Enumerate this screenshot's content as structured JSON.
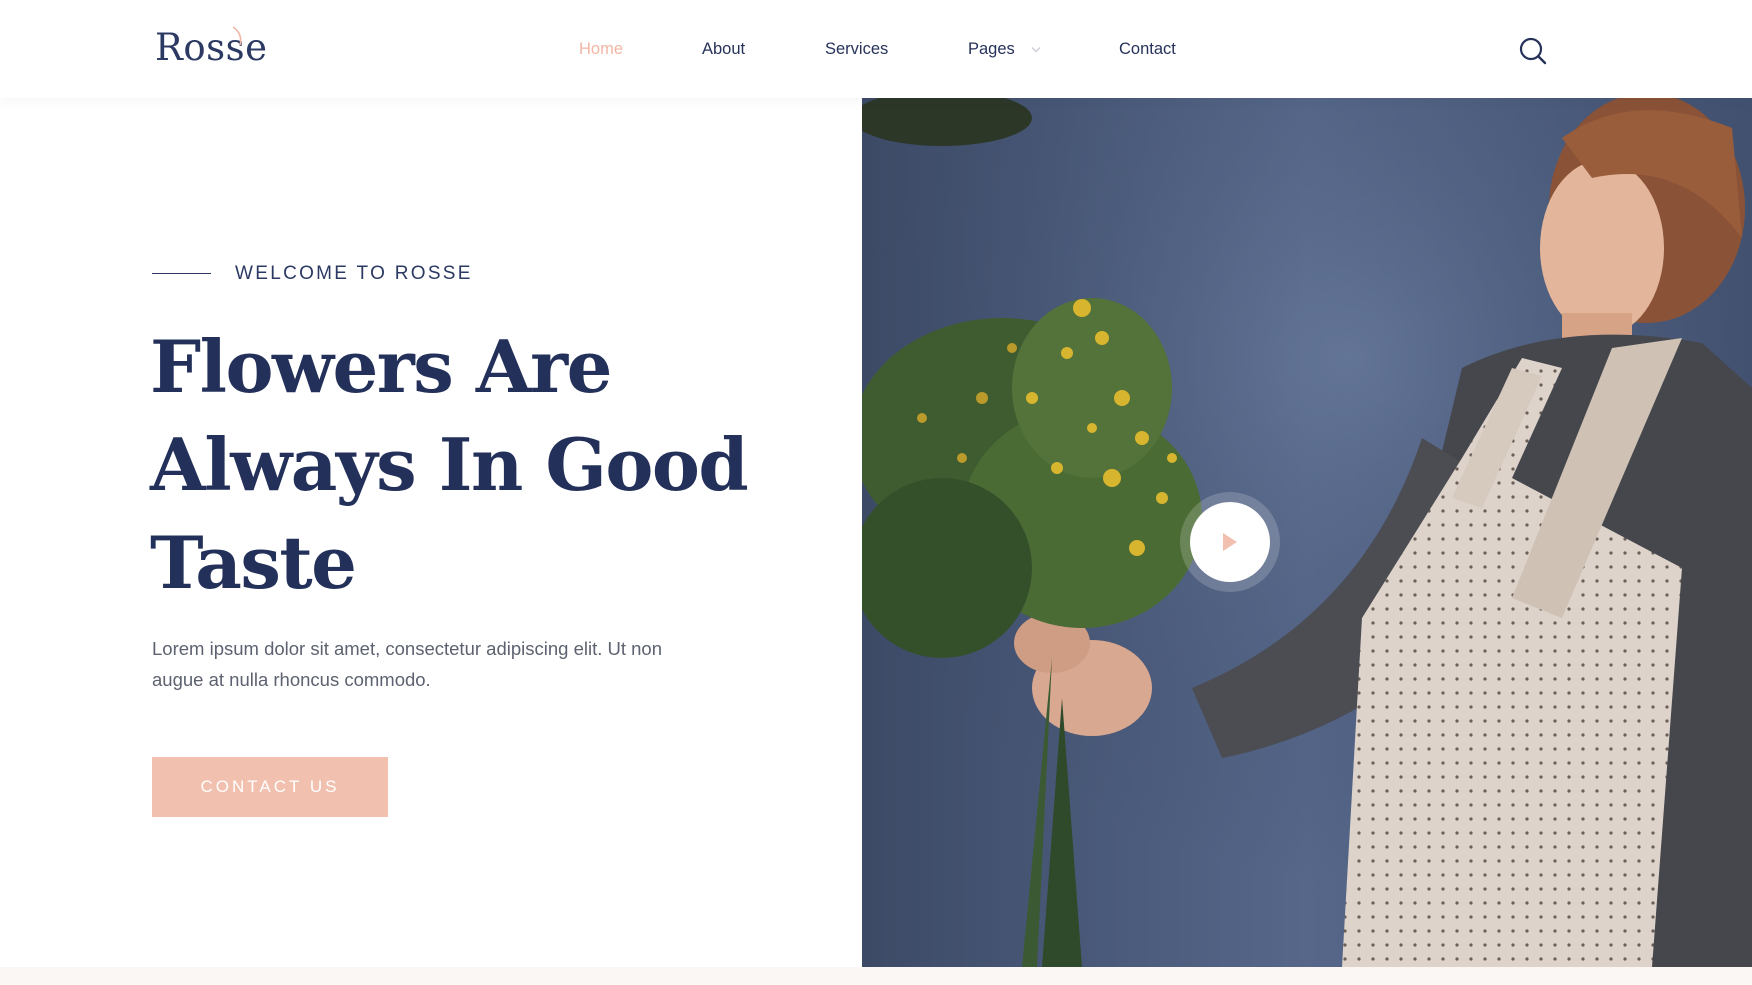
{
  "brand": {
    "name": "Rosse",
    "accent_color": "#f0b6a3",
    "primary_color": "#23305a"
  },
  "nav": {
    "items": [
      {
        "label": "Home",
        "active": true
      },
      {
        "label": "About",
        "active": false
      },
      {
        "label": "Services",
        "active": false
      },
      {
        "label": "Pages",
        "active": false,
        "has_dropdown": true
      },
      {
        "label": "Contact",
        "active": false
      }
    ],
    "search_icon": "search-icon"
  },
  "hero": {
    "eyebrow": "WELCOME TO ROSSE",
    "title_lines": [
      "Flowers Are",
      "Always In Good",
      "Taste"
    ],
    "description": "Lorem ipsum dolor sit amet, consectetur adipiscing elit. Ut non augue at nulla rhoncus commodo.",
    "cta_label": "CONTACT US",
    "cta_color": "#f1c0ae",
    "image": "florist-holding-bouquet",
    "play_icon": "play-icon"
  }
}
